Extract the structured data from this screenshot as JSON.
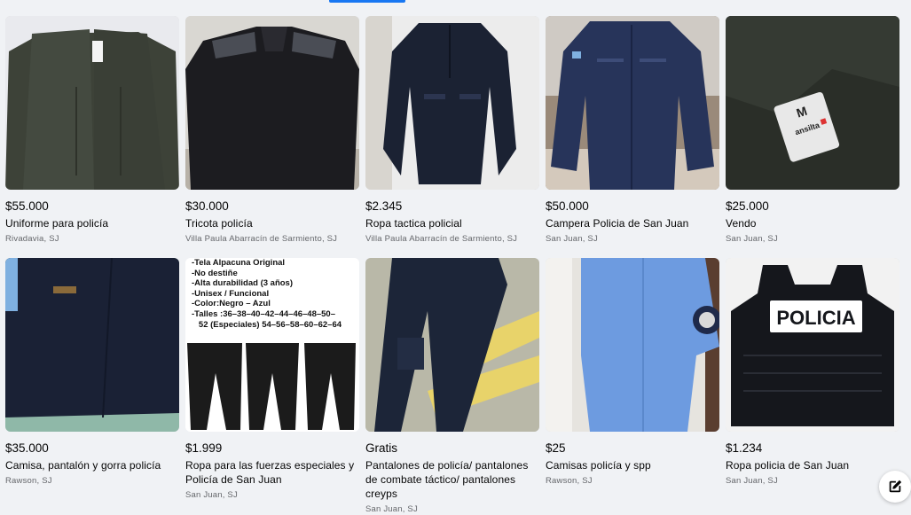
{
  "colors": {
    "accent": "#1877f2",
    "price": "#050505",
    "location": "#65676b"
  },
  "listings": [
    {
      "price": "$55.000",
      "title": "Uniforme para policía",
      "location": "Rivadavia, SJ"
    },
    {
      "price": "$30.000",
      "title": "Tricota policía",
      "location": "Villa Paula Abarracín de Sarmiento, SJ"
    },
    {
      "price": "$2.345",
      "title": "Ropa tactica policial",
      "location": "Villa Paula Abarracín de Sarmiento, SJ"
    },
    {
      "price": "$50.000",
      "title": "Campera Policia de San Juan",
      "location": "San Juan, SJ"
    },
    {
      "price": "$25.000",
      "title": "Vendo",
      "location": "San Juan, SJ"
    },
    {
      "price": "$35.000",
      "title": "Camisa, pantalón y gorra policía",
      "location": "Rawson, SJ"
    },
    {
      "price": "$1.999",
      "title": "Ropa para las fuerzas especiales y Policía de San Juan",
      "location": "San Juan, SJ"
    },
    {
      "price": "Gratis",
      "title": "Pantalones de policía/ pantalones de combate táctico/ pantalones creyps",
      "location": "San Juan, SJ"
    },
    {
      "price": "$25",
      "title": "Camisas policía y spp",
      "location": "Rawson, SJ"
    },
    {
      "price": "$1.234",
      "title": "Ropa policia de San Juan",
      "location": "San Juan, SJ"
    }
  ],
  "image_texts": {
    "tag_size": "M",
    "tag_brand": "ansilta",
    "vest_label": "POLICIA",
    "pants_lines": "-Tela Alpacuna Original\n-No destiñe\n-Alta durabilidad (3 años)\n-Unisex / Funcional\n-Color:Negro – Azul\n-Talles :36–38–40–42–44–46–48–50–\n   52 (Especiales) 54–56–58–60–62–64"
  },
  "icons": {
    "compose": "compose-icon"
  }
}
